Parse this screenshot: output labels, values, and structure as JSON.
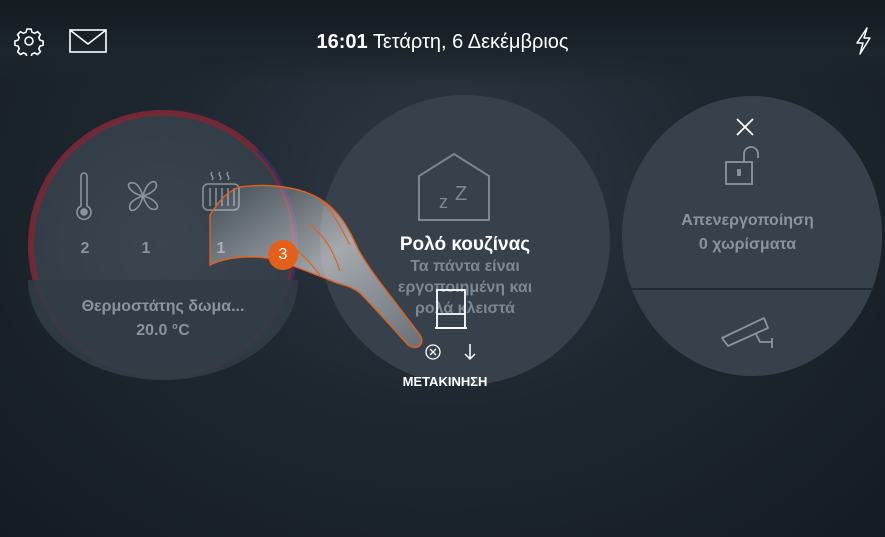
{
  "header": {
    "time": "16:01",
    "date": "Τετάρτη, 6 Δεκέμβριος"
  },
  "thermostat": {
    "counts": [
      "2",
      "1",
      "1"
    ],
    "name": "Θερμοστάτης δωμα...",
    "temperature": "20.0 °C"
  },
  "scenario": {
    "line1": "Τα πάντα είναι",
    "line2": "εργοποιημένη και",
    "line3": "ρολά κλειστά"
  },
  "popup": {
    "title": "Ρολό κουζίνας",
    "action_label": "ΜΕΤΑΚΙΝΗΣΗ"
  },
  "alarm": {
    "line1": "Απενεργοποίηση",
    "line2": "0 χωρίσματα"
  },
  "step_badge": "3",
  "colors": {
    "badge": "#e4601a",
    "card": "#36414b",
    "ring_red": "#8a1f2e"
  }
}
